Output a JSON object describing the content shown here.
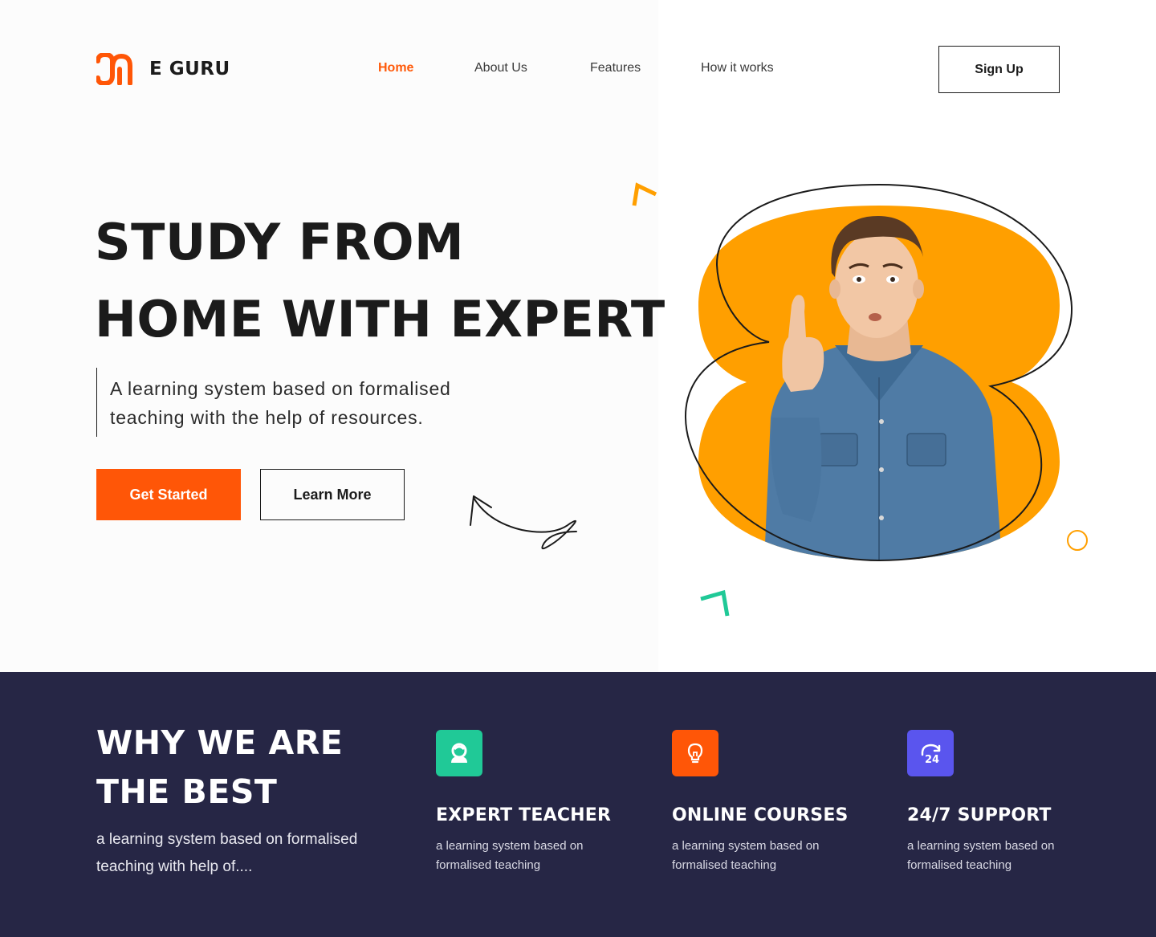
{
  "brand": {
    "name": "E GURU",
    "logo_icon": "eguru-logo-icon",
    "accent": "#ff5607"
  },
  "nav": {
    "items": [
      {
        "label": "Home",
        "active": true
      },
      {
        "label": "About Us",
        "active": false
      },
      {
        "label": "Features",
        "active": false
      },
      {
        "label": "How it works",
        "active": false
      }
    ],
    "signup_label": "Sign Up"
  },
  "hero": {
    "headline_line1": "STUDY FROM",
    "headline_line2": "HOME WITH EXPERT",
    "subtext": "A learning system based on formalised teaching with the help of resources.",
    "primary_button": "Get Started",
    "secondary_button": "Learn More",
    "blob_color": "#ff9f00"
  },
  "features": {
    "title_line1": "WHY WE ARE",
    "title_line2": "THE BEST",
    "description": "a learning system based on formalised teaching with help of....",
    "background": "#262645",
    "items": [
      {
        "title": "EXPERT TEACHER",
        "desc": "a learning system based on formalised teaching",
        "icon": "teacher-icon",
        "color": "#20c997"
      },
      {
        "title": "ONLINE COURSES",
        "desc": "a learning system based on formalised teaching",
        "icon": "lightbulb-icon",
        "color": "#ff5607"
      },
      {
        "title": "24/7 SUPPORT",
        "desc": "a learning system based on formalised teaching",
        "icon": "support-24-icon",
        "color": "#5a55ee"
      }
    ]
  }
}
